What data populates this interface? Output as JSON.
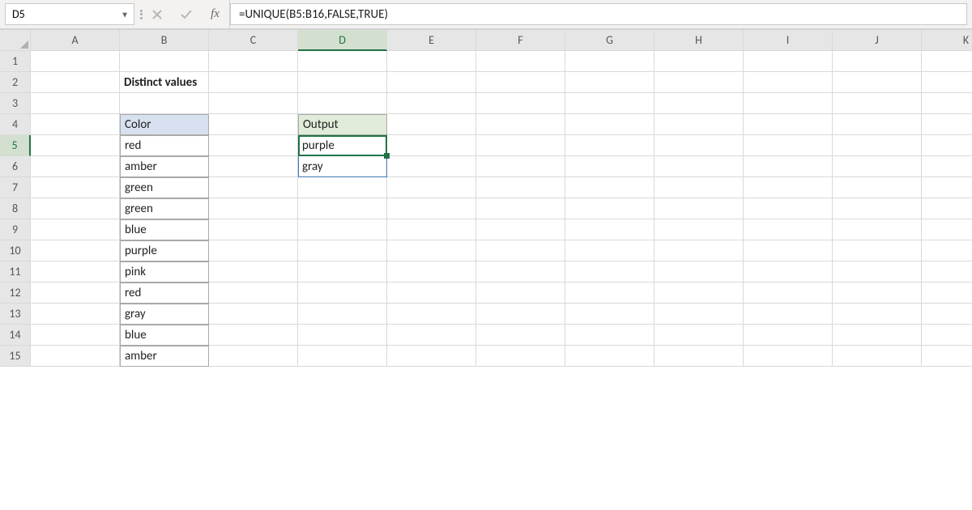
{
  "formula_bar": {
    "name_box": "D5",
    "fx_label": "fx",
    "formula": "=UNIQUE(B5:B16,FALSE,TRUE)"
  },
  "columns": [
    "A",
    "B",
    "C",
    "D",
    "E",
    "F",
    "G",
    "H",
    "I",
    "J",
    "K"
  ],
  "rows": [
    "1",
    "2",
    "3",
    "4",
    "5",
    "6",
    "7",
    "8",
    "9",
    "10",
    "11",
    "12",
    "13",
    "14",
    "15"
  ],
  "active_cell": "D5",
  "title_cell": {
    "ref": "B2",
    "text": "Distinct values"
  },
  "headers": {
    "color": "Color",
    "output": "Output"
  },
  "color_values": [
    "red",
    "amber",
    "green",
    "green",
    "blue",
    "purple",
    "pink",
    "red",
    "gray",
    "blue",
    "amber"
  ],
  "output_values": [
    "purple",
    "gray"
  ]
}
